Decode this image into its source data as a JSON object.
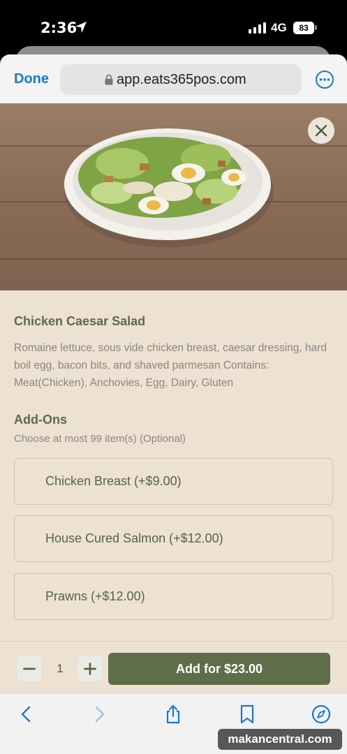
{
  "status_bar": {
    "time": "2:36",
    "network": "4G",
    "battery": "83"
  },
  "browser": {
    "done_label": "Done",
    "url": "app.eats365pos.com"
  },
  "item": {
    "title": "Chicken Caesar Salad",
    "description": "Romaine lettuce, sous vide chicken breast, caesar dressing, hard boil egg, bacon bits, and shaved parmesan Contains: Meat(Chicken), Anchovies, Egg, Dairy, Gluten"
  },
  "addons": {
    "title": "Add-Ons",
    "subtitle": "Choose at most 99 item(s) (Optional)",
    "options": [
      {
        "label": "Chicken Breast (+$9.00)"
      },
      {
        "label": "House Cured Salmon (+$12.00)"
      },
      {
        "label": "Prawns (+$12.00)"
      }
    ]
  },
  "cart": {
    "quantity": "1",
    "add_label": "Add for $23.00"
  },
  "watermark": "makancentral.com",
  "colors": {
    "accent_green": "#5f6e48",
    "panel_bg": "#ede1d2",
    "link_blue": "#1c78c9"
  }
}
